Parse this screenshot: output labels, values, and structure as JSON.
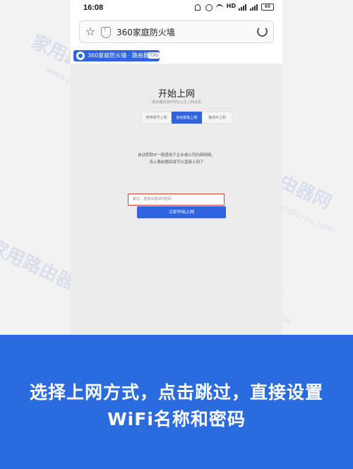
{
  "status_bar": {
    "time": "16:08",
    "hd_label": "HD",
    "battery": "65"
  },
  "browser": {
    "url_text": "360家庭防火墙"
  },
  "router_page": {
    "brand_text": "360家庭防火墙 · 路由器",
    "brand_badge": "T3G",
    "title": "开始上网",
    "subtitle": "路由器获取IP地址以及上网设置",
    "tabs": [
      {
        "label": "宽带拨号上网",
        "active": false
      },
      {
        "label": "自动获取上网",
        "active": true
      },
      {
        "label": "静态IP上网",
        "active": false
      }
    ],
    "info_lines": [
      "自动获取IP一般适用于企业或公司内部网络。",
      "连上路由器后就可以直接上网了"
    ],
    "input_placeholder": "跳过，直接设置WiFi密码",
    "submit_label": "立即开始上网"
  },
  "caption": {
    "line1": "选择上网方式，点击跳过，直接设置",
    "line2": "WiFi名称和密码"
  },
  "watermark": {
    "text": "家用路由器网",
    "url": "www.jiayongluyou.com"
  }
}
